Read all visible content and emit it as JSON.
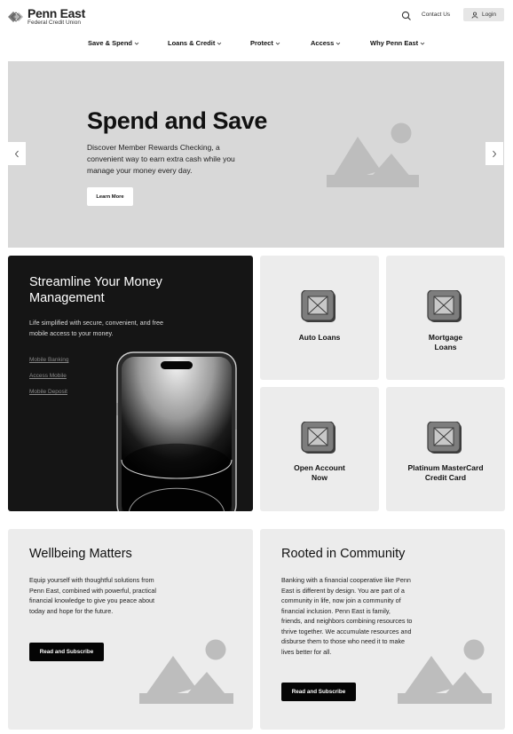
{
  "header": {
    "logo_name": "Penn East",
    "logo_sub": "Federal Credit Union",
    "contact_label": "Contact Us",
    "login_label": "Login"
  },
  "nav": {
    "items": [
      {
        "label": "Save & Spend"
      },
      {
        "label": "Loans & Credit"
      },
      {
        "label": "Protect"
      },
      {
        "label": "Access"
      },
      {
        "label": "Why Penn East"
      }
    ]
  },
  "hero": {
    "title": "Spend and Save",
    "description": "Discover Member Rewards Checking, a convenient way to earn extra cash while you manage your money every day.",
    "cta_label": "Learn More",
    "slide_count": 3,
    "active_slide": 1
  },
  "mobile_card": {
    "title": "Streamline Your Money Management",
    "description": "Life simplified with secure, convenient, and free mobile access to your money.",
    "links": [
      {
        "label": "Mobile Banking"
      },
      {
        "label": "Access Mobile"
      },
      {
        "label": "Mobile Deposit"
      }
    ]
  },
  "tiles": [
    {
      "label": "Auto Loans",
      "icon": "image-placeholder-icon"
    },
    {
      "label": "Mortgage Loans",
      "icon": "image-placeholder-icon"
    },
    {
      "label": "Open Account Now",
      "icon": "image-placeholder-icon"
    },
    {
      "label": "Platinum MasterCard Credit Card",
      "icon": "image-placeholder-icon"
    }
  ],
  "wellbeing": {
    "title": "Wellbeing Matters",
    "description": "Equip yourself with thoughtful solutions from Penn East, combined with powerful, practical financial knowledge to give you peace about today and hope for the future.",
    "cta_label": "Read and Subscribe"
  },
  "community": {
    "title": "Rooted in Community",
    "description": "Banking with a financial cooperative like Penn East is different by design. You are part of a community in life, now join a community of financial inclusion. Penn East is family, friends, and neighbors combining resources to thrive together. We accumulate resources and disburse them to those who need it to make lives better for all.",
    "cta_label": "Read and Subscribe"
  },
  "colors": {
    "hero_bg": "#d8d8d8",
    "dark_card_bg": "#151515",
    "tile_bg": "#ececec",
    "button_dark": "#050505",
    "placeholder_gray": "#bdbdbd"
  }
}
